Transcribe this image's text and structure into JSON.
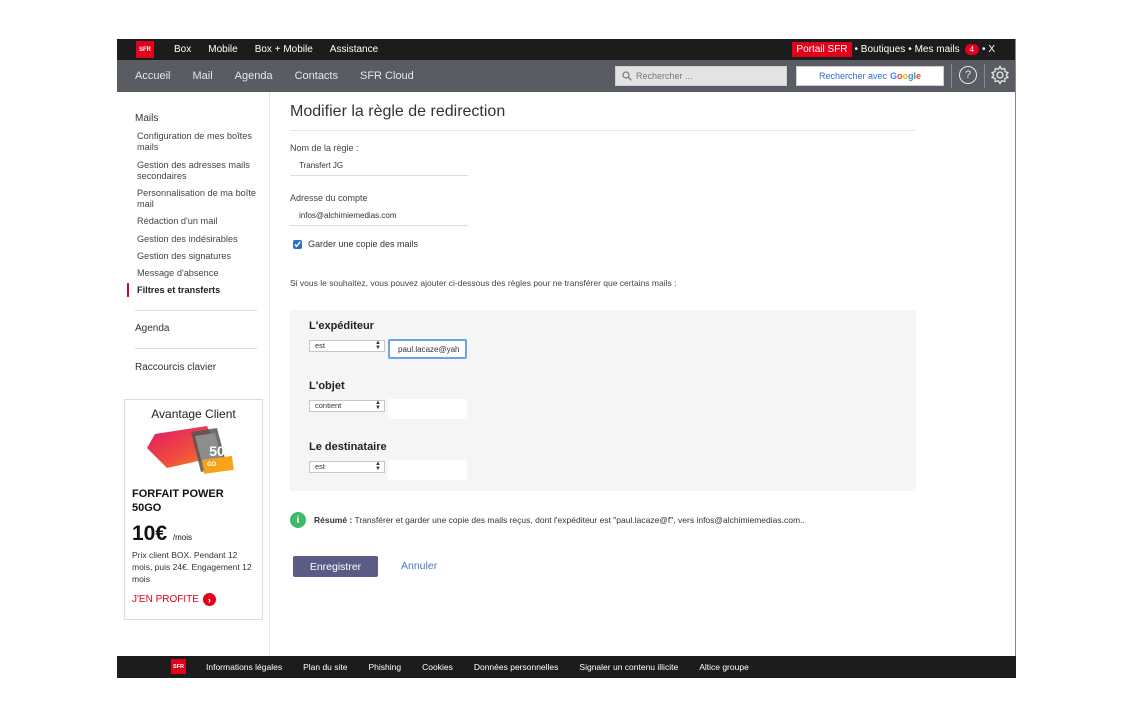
{
  "brand": {
    "logo_text": "SFR",
    "accent": "#e2001a"
  },
  "topbar": {
    "nav": [
      "Box",
      "Mobile",
      "Box + Mobile",
      "Assistance"
    ],
    "portail": "Portail SFR",
    "boutiques": "• Boutiques",
    "mes_mails": "• Mes mails",
    "mail_count": "4",
    "close": "• X"
  },
  "navbar": {
    "items": [
      "Accueil",
      "Mail",
      "Agenda",
      "Contacts",
      "SFR Cloud"
    ],
    "search_placeholder": "Rechercher ...",
    "google_label": "Rechercher avec",
    "google_logo": "Google",
    "help": "?"
  },
  "sidebar": {
    "mails_title": "Mails",
    "mails_items": [
      "Configuration de mes boîtes mails",
      "Gestion des adresses mails secondaires",
      "Personnalisation de ma boîte mail",
      "Rédaction d'un mail",
      "Gestion des indésirables",
      "Gestion des signatures",
      "Message d'absence",
      "Filtres et transferts"
    ],
    "agenda": "Agenda",
    "shortcuts": "Raccourcis clavier",
    "promo": {
      "title": "Avantage Client",
      "image_text": "50",
      "image_sub": "GO",
      "name": "FORFAIT POWER 50GO",
      "price": "10€",
      "price_unit": "/mois",
      "desc": "Prix client BOX. Pendant 12 mois, puis 24€. Engagement 12 mois",
      "cta": "J'EN PROFITE"
    }
  },
  "main": {
    "title": "Modifier la règle de redirection",
    "rule_name_label": "Nom de la règle :",
    "rule_name_value": "Transfert JG",
    "account_label": "Adresse du compte",
    "account_value": "infos@alchimiemedias.com",
    "keep_copy_label": "Garder une copie des mails",
    "keep_copy_checked": true,
    "intro": "Si vous le souhaitez, vous pouvez ajouter ci-dessous des règles pour ne transférer que certains mails :",
    "rules": [
      {
        "title": "L'expéditeur",
        "operator": "est",
        "value": "paul.lacaze@yah"
      },
      {
        "title": "L'objet",
        "operator": "contient",
        "value": ""
      },
      {
        "title": "Le destinataire",
        "operator": "est",
        "value": ""
      }
    ],
    "summary_label": "Résumé :",
    "summary_text": "Transférer et garder une copie des mails reçus, dont l'expéditeur est \"paul.lacaze@f\", vers infos@alchimiemedias.com..",
    "save": "Enregistrer",
    "cancel": "Annuler"
  },
  "footer": {
    "links": [
      "Informations légales",
      "Plan du site",
      "Phishing",
      "Cookies",
      "Données personnelles",
      "Signaler un contenu illicite",
      "Altice groupe"
    ]
  }
}
